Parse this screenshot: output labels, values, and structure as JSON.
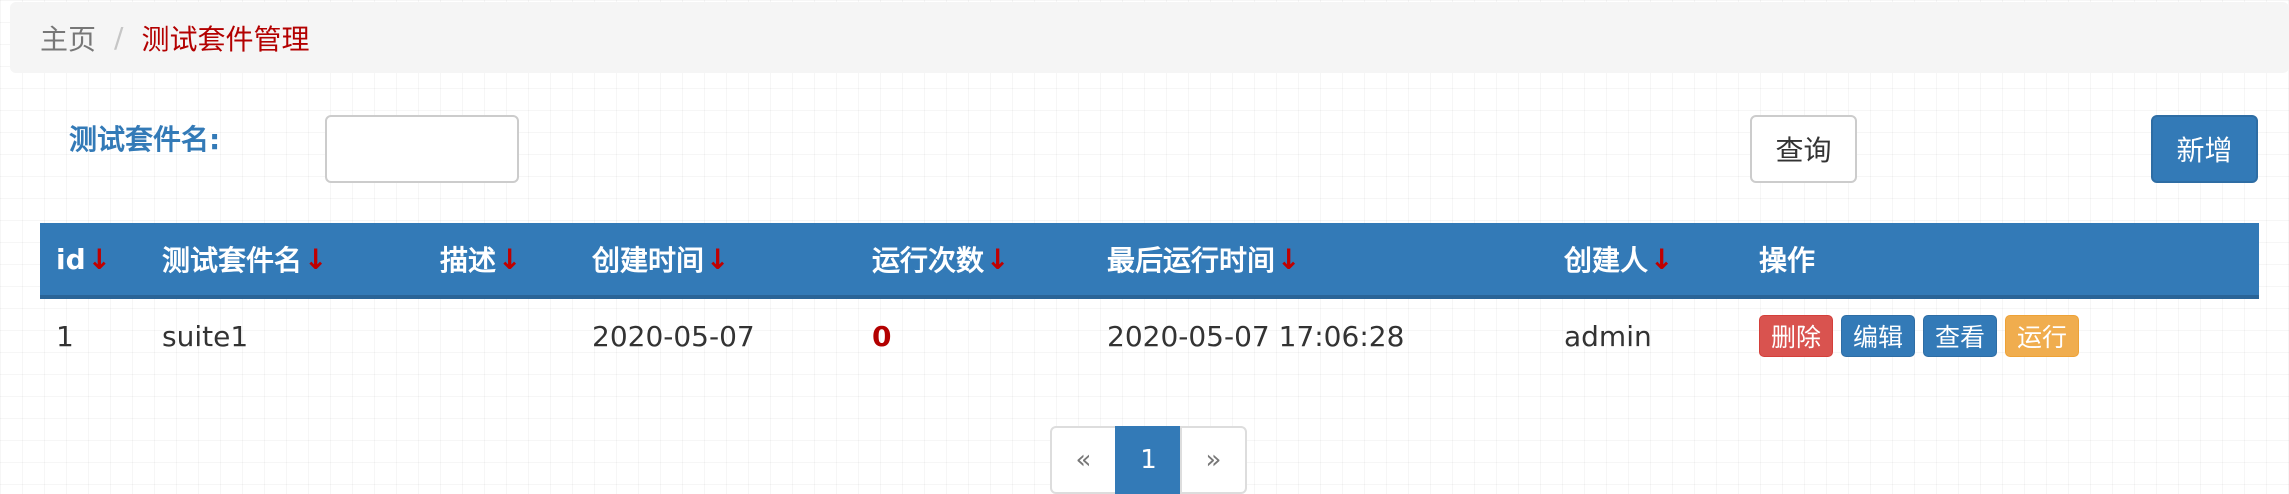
{
  "breadcrumb": {
    "home": "主页",
    "separator": "/",
    "current": "测试套件管理"
  },
  "filter": {
    "label": "测试套件名:",
    "value": "",
    "placeholder": ""
  },
  "buttons": {
    "query": "查询",
    "add": "新增"
  },
  "table": {
    "sort_arrow": "↓",
    "columns": [
      "id",
      "测试套件名",
      "描述",
      "创建时间",
      "运行次数",
      "最后运行时间",
      "创建人",
      "操作"
    ],
    "rows": [
      {
        "id": "1",
        "name": "suite1",
        "description": "",
        "created": "2020-05-07",
        "run_count": "0",
        "last_run": "2020-05-07 17:06:28",
        "creator": "admin",
        "actions": {
          "delete": "删除",
          "edit": "编辑",
          "view": "查看",
          "run": "运行"
        }
      }
    ]
  },
  "pagination": {
    "prev": "«",
    "current": "1",
    "next": "»"
  },
  "colors": {
    "primary": "#337ab7",
    "danger": "#d9534f",
    "warning": "#f0ad4e",
    "breadcrumb_active": "#b30000"
  }
}
